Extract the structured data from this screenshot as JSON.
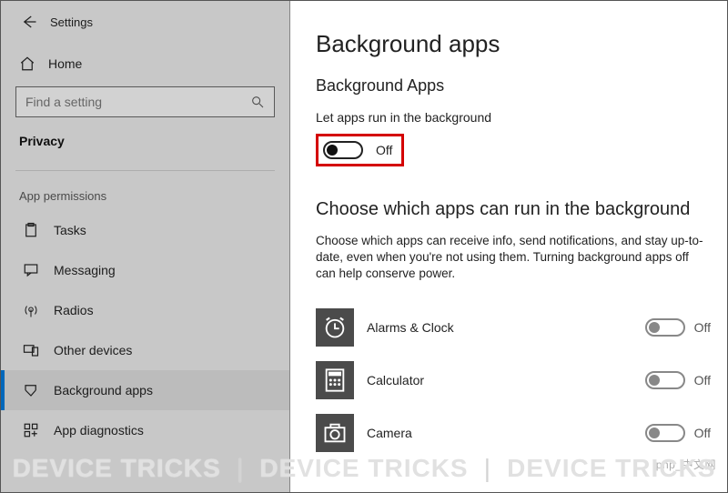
{
  "window": {
    "title": "Settings"
  },
  "sidebar": {
    "home_label": "Home",
    "search_placeholder": "Find a setting",
    "privacy_header": "Privacy",
    "section_header": "App permissions",
    "items": [
      {
        "label": "Tasks"
      },
      {
        "label": "Messaging"
      },
      {
        "label": "Radios"
      },
      {
        "label": "Other devices"
      },
      {
        "label": "Background apps"
      },
      {
        "label": "App diagnostics"
      }
    ]
  },
  "main": {
    "title": "Background apps",
    "subheading": "Background Apps",
    "master_toggle_label": "Let apps run in the background",
    "master_toggle_state": "Off",
    "choose_heading": "Choose which apps can run in the background",
    "choose_desc": "Choose which apps can receive info, send notifications, and stay up-to-date, even when you're not using them. Turning background apps off can help conserve power.",
    "apps": [
      {
        "name": "Alarms & Clock",
        "state": "Off"
      },
      {
        "name": "Calculator",
        "state": "Off"
      },
      {
        "name": "Camera",
        "state": "Off"
      }
    ]
  },
  "watermarks": {
    "brand": "DEVICE TRICKS",
    "php": "php_中文网"
  }
}
